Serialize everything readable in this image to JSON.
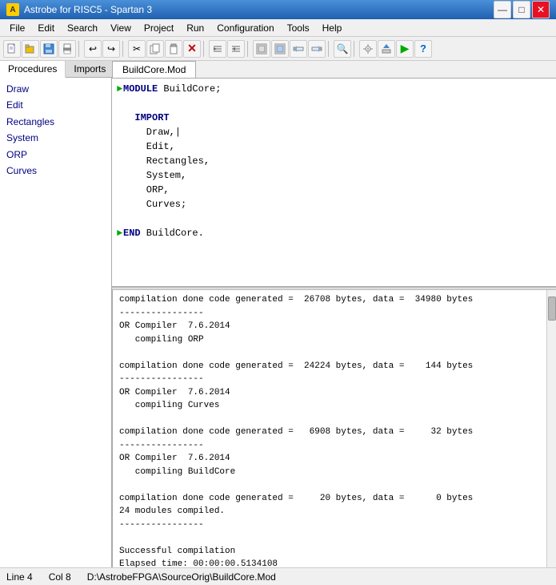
{
  "window": {
    "title": "Astrobe for RISC5  -  Spartan 3",
    "title_icon": "A"
  },
  "title_controls": [
    "—",
    "□",
    "✕"
  ],
  "menu": {
    "items": [
      "File",
      "Edit",
      "Search",
      "View",
      "Project",
      "Run",
      "Configuration",
      "Tools",
      "Help"
    ]
  },
  "toolbar": {
    "buttons": [
      {
        "icon": "📄",
        "name": "new"
      },
      {
        "icon": "📂",
        "name": "open"
      },
      {
        "icon": "💾",
        "name": "save"
      },
      {
        "icon": "🖨",
        "name": "print-preview"
      },
      {
        "icon": "❓",
        "name": "help1"
      },
      {
        "icon": "✂",
        "name": "cut"
      },
      {
        "icon": "📋",
        "name": "paste"
      },
      {
        "icon": "⬅",
        "name": "undo"
      },
      {
        "icon": "➡",
        "name": "redo"
      },
      {
        "icon": "🔲",
        "name": "tool1"
      },
      {
        "icon": "🔳",
        "name": "tool2"
      },
      {
        "icon": "▦",
        "name": "tool3"
      },
      {
        "icon": "▧",
        "name": "tool4"
      },
      {
        "icon": "▣",
        "name": "tool5"
      },
      {
        "icon": "⬛",
        "name": "tool6"
      },
      {
        "icon": "🔍",
        "name": "search"
      },
      {
        "icon": "⚙",
        "name": "config"
      },
      {
        "icon": "▶",
        "name": "run"
      },
      {
        "icon": "⭕",
        "name": "stop"
      }
    ]
  },
  "sidebar": {
    "tabs": [
      {
        "label": "Procedures",
        "active": true
      },
      {
        "label": "Imports",
        "active": false
      }
    ],
    "procedures": [
      "Draw",
      "Edit",
      "Rectangles",
      "System",
      "ORP",
      "Curves"
    ]
  },
  "editor": {
    "tab": "BuildCore.Mod",
    "lines": [
      {
        "marker": "►",
        "content": "MODULE BuildCore;"
      },
      {
        "marker": "",
        "content": ""
      },
      {
        "marker": "",
        "content": "  IMPORT"
      },
      {
        "marker": "",
        "content": "    Draw,|"
      },
      {
        "marker": "",
        "content": "    Edit,"
      },
      {
        "marker": "",
        "content": "    Rectangles,"
      },
      {
        "marker": "",
        "content": "    System,"
      },
      {
        "marker": "",
        "content": "    ORP,"
      },
      {
        "marker": "",
        "content": "    Curves;"
      },
      {
        "marker": "",
        "content": ""
      },
      {
        "marker": "►",
        "content": "END BuildCore."
      }
    ]
  },
  "output": {
    "lines": [
      "compilation done code generated =  26708 bytes, data =  34980 bytes",
      "----------------",
      "OR Compiler  7.6.2014",
      "   compiling ORP",
      "",
      "compilation done code generated =  24224 bytes, data =    144 bytes",
      "----------------",
      "OR Compiler  7.6.2014",
      "   compiling Curves",
      "",
      "compilation done code generated =   6908 bytes, data =     32 bytes",
      "----------------",
      "OR Compiler  7.6.2014",
      "   compiling BuildCore",
      "",
      "compilation done code generated =     20 bytes, data =      0 bytes",
      "24 modules compiled.",
      "----------------",
      "",
      "Successful compilation",
      "Elapsed time: 00:00:00.5134108"
    ]
  },
  "status": {
    "line": "Line 4",
    "col": "Col 8",
    "path": "D:\\AstrobeFPGA\\SourceOrig\\BuildCore.Mod"
  }
}
